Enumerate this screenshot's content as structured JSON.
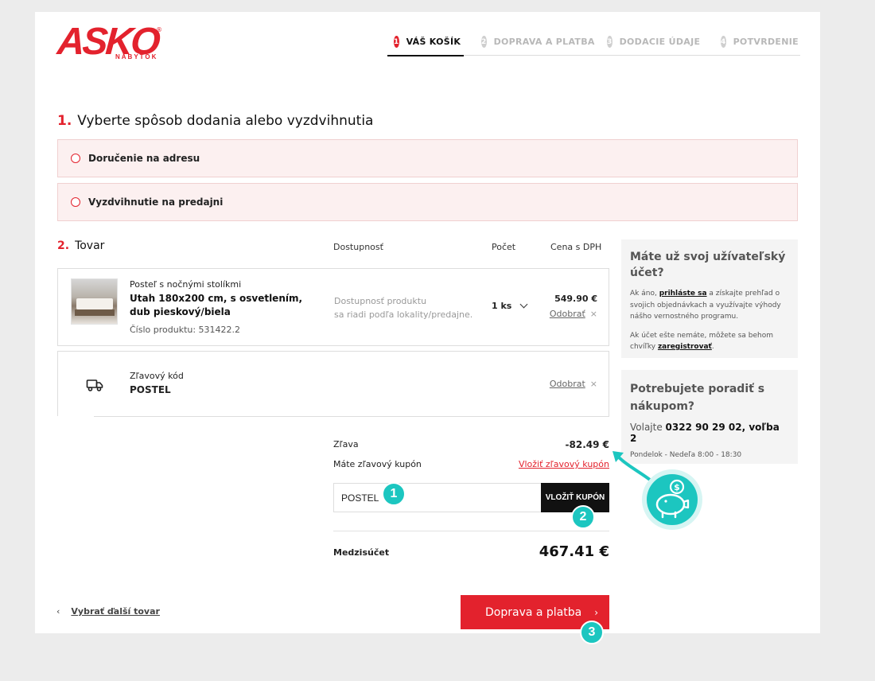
{
  "brand": {
    "logo": "ASKO",
    "logo_sub": "NÁBYTOK",
    "registered": "®"
  },
  "steps": [
    {
      "num": "1",
      "label": "VÁŠ KOŠÍK",
      "active": true
    },
    {
      "num": "2",
      "label": "DOPRAVA A PLATBA",
      "active": false
    },
    {
      "num": "3",
      "label": "DODACIE ÚDAJE",
      "active": false
    },
    {
      "num": "4",
      "label": "POTVRDENIE",
      "active": false
    }
  ],
  "delivery": {
    "num": "1.",
    "title": "Vyberte spôsob dodania alebo vyzdvihnutia",
    "options": [
      "Doručenie na adresu",
      "Vyzdvihnutie na predajni"
    ]
  },
  "cart": {
    "num": "2.",
    "title": "Tovar",
    "columns": {
      "availability": "Dostupnosť",
      "count": "Počet",
      "price": "Cena s DPH"
    },
    "item": {
      "subtitle": "Posteľ s nočnými stolíkmi",
      "name": "Utah 180x200 cm, s osvetlením, dub pieskový/biela",
      "code": "Číslo produktu: 531422.2",
      "availability_line1": "Dostupnosť produktu",
      "availability_line2": "sa riadi podľa lokality/predajne.",
      "qty": "1 ks",
      "price": "549.90 €",
      "remove": "Odobrať",
      "remove_x": "×"
    },
    "discount_item": {
      "label": "Zľavový kód",
      "code": "POSTEL",
      "remove": "Odobrat",
      "remove_x": "×",
      "icon": "truck-icon"
    }
  },
  "summary": {
    "discount_label": "Zľava",
    "discount_value": "-82.49 €",
    "coupon_question": "Máte zľavový kupón",
    "coupon_link": "Vložiť zľavový kupón",
    "coupon_input_value": "POSTEL",
    "coupon_button": "VLOŽIŤ KUPÓN",
    "subtotal_label": "Medzisúčet",
    "subtotal_value": "467.41 €"
  },
  "footer": {
    "back_arrow": "‹",
    "back_link": "Vybrať ďalší tovar",
    "next_button": "Doprava a platba",
    "next_arrow": "›"
  },
  "sidebar": {
    "account_title": "Máte už svoj užívateľský účet?",
    "account_p1_pre": "Ak áno, ",
    "account_p1_link": "prihláste sa",
    "account_p1_post": " a získajte prehľad o svojich objednávkach a využívajte výhody nášho vernostného programu.",
    "account_p2_pre": "Ak účet ešte nemáte, môžete sa behom chvíľky ",
    "account_p2_link": "zaregistrovať",
    "account_p2_post": ".",
    "help_title": "Potrebujete poradiť s nákupom?",
    "help_phone_pre": "Volajte ",
    "help_phone": "0322 90 29 02, voľba 2",
    "help_hours": "Pondelok - Nedeľa 8:00 - 18:30"
  },
  "markers": [
    "1",
    "2",
    "3"
  ],
  "colors": {
    "brand_red": "#e3222d",
    "teal": "#1cc6c0",
    "option_bg": "#fcf0f0",
    "sidebar_bg": "#f4f4f4"
  }
}
